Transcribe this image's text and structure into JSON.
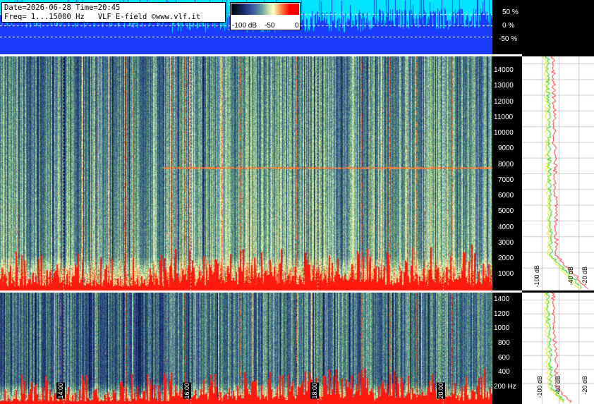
{
  "info": {
    "line1": "Date=2026-06-28 Time=20:45",
    "line2": "Freq= 1...15000 Hz   VLF E-field ©www.vlf.it"
  },
  "color_scale": {
    "labels": [
      "-100 dB",
      "-50",
      "0"
    ]
  },
  "percent_axis": [
    "50 %",
    "0 %",
    "-50 %"
  ],
  "upper_freq_axis": [
    "14000",
    "13000",
    "12000",
    "11000",
    "10000",
    "9000",
    "8000",
    "7000",
    "6000",
    "5000",
    "4000",
    "3000",
    "2000",
    "1000"
  ],
  "lower_freq_axis": [
    "1400",
    "1200",
    "1000",
    "800",
    "600",
    "400",
    "200 Hz"
  ],
  "time_labels": [
    "14:00",
    "16:00",
    "18:00",
    "20:00"
  ],
  "upper_db_labels": [
    "-100 dB",
    "-40 dB",
    "-20 dB"
  ],
  "lower_db_labels": [
    "-100 dB",
    "-40 dB",
    "-20 dB"
  ],
  "colors": {
    "background": "#000000",
    "top_strip": "#00e5ff",
    "strip_signal": "#1a3cff",
    "trace_red": "#ff2020",
    "trace_green": "#00cc00",
    "trace_yellow": "#e8e800"
  }
}
